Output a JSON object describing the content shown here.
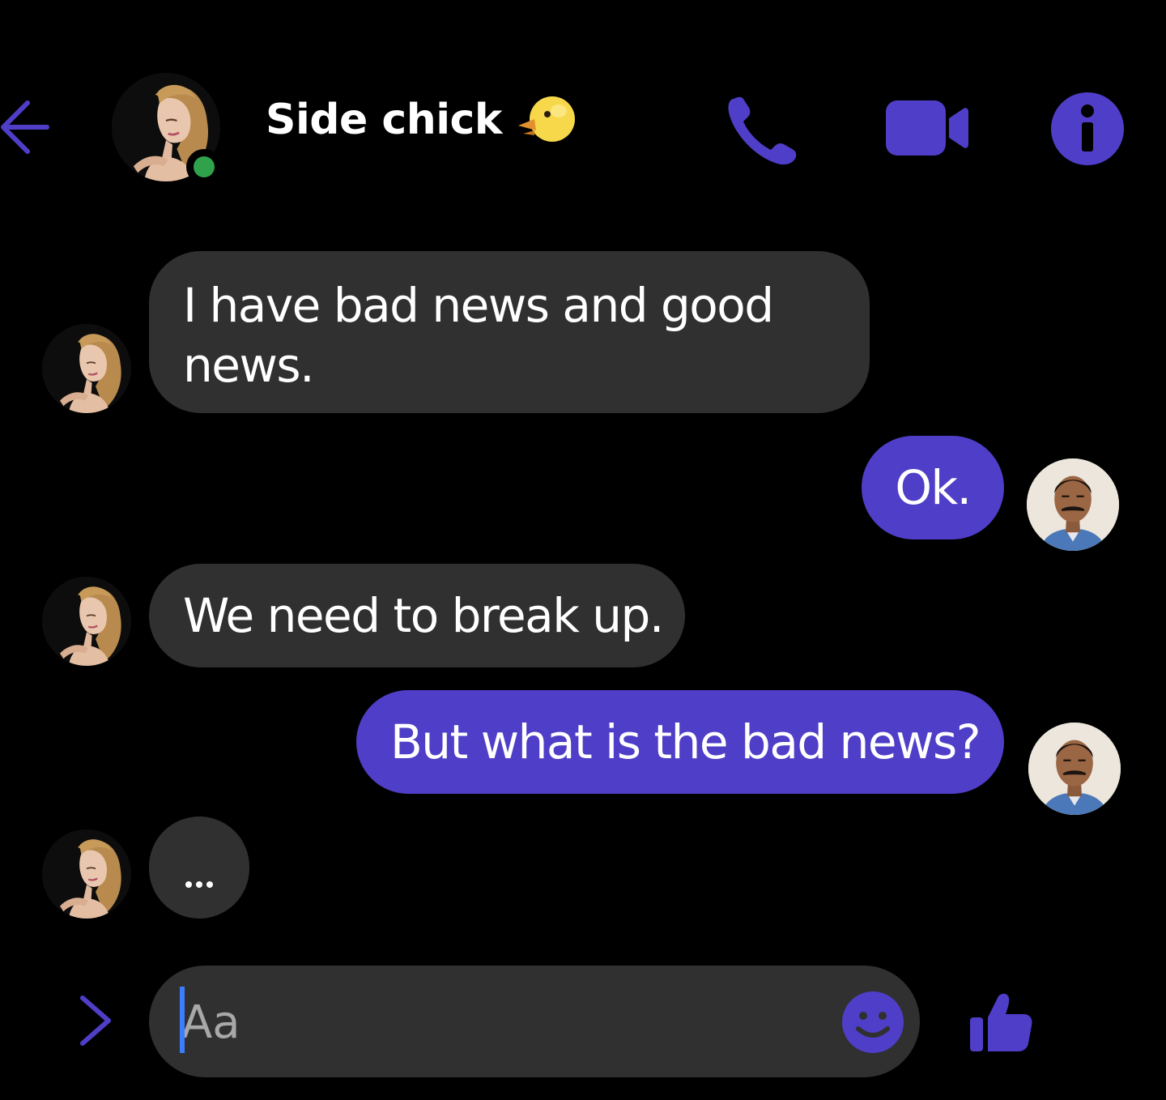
{
  "header": {
    "title": "Side chick",
    "title_emoji": "chick-emoji",
    "online": true,
    "back_icon": "arrow-left-icon",
    "call_icon": "phone-icon",
    "video_icon": "video-camera-icon",
    "info_icon": "info-icon"
  },
  "messages": [
    {
      "from": "contact",
      "text": "I have bad news and good news."
    },
    {
      "from": "me",
      "text": "Ok."
    },
    {
      "from": "contact",
      "text": "We need to break up."
    },
    {
      "from": "me",
      "text": "But what is the bad news?"
    },
    {
      "from": "contact",
      "text": "",
      "typing": true
    }
  ],
  "composer": {
    "placeholder": "Aa",
    "value": "",
    "expand_icon": "chevron-right-icon",
    "emoji_icon": "smiley-icon",
    "send_icon": "thumbs-up-icon"
  },
  "colors": {
    "background": "#000000",
    "accent": "#4f3ec7",
    "incoming_bubble": "#303030",
    "online": "#31a24c"
  }
}
